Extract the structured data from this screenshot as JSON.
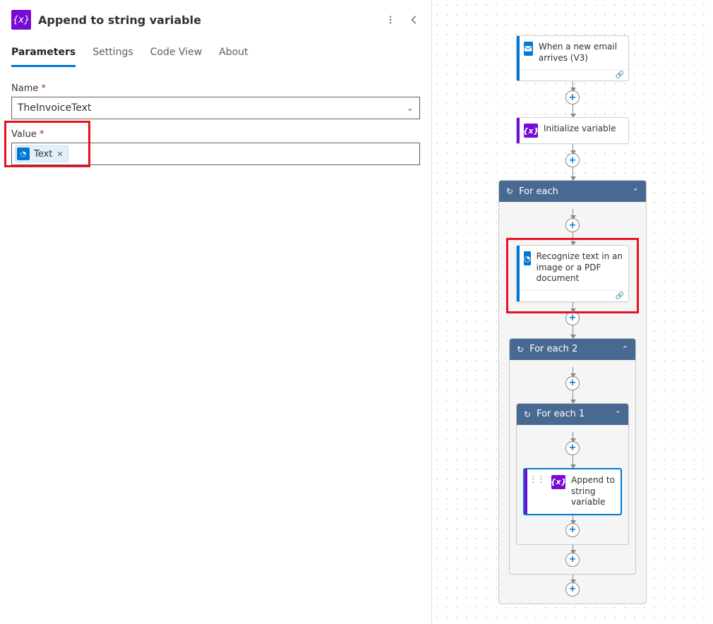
{
  "panel": {
    "title": "Append to string variable",
    "tabs": {
      "parameters": "Parameters",
      "settings": "Settings",
      "codeview": "Code View",
      "about": "About"
    },
    "name_label": "Name",
    "name_value": "TheInvoiceText",
    "value_label": "Value",
    "value_token": "Text"
  },
  "flow": {
    "email": "When a new email arrives (V3)",
    "init": "Initialize variable",
    "foreach": "For each",
    "recognize": "Recognize text in an image or a PDF document",
    "foreach2": "For each 2",
    "foreach1": "For each 1",
    "append": "Append to string variable"
  }
}
